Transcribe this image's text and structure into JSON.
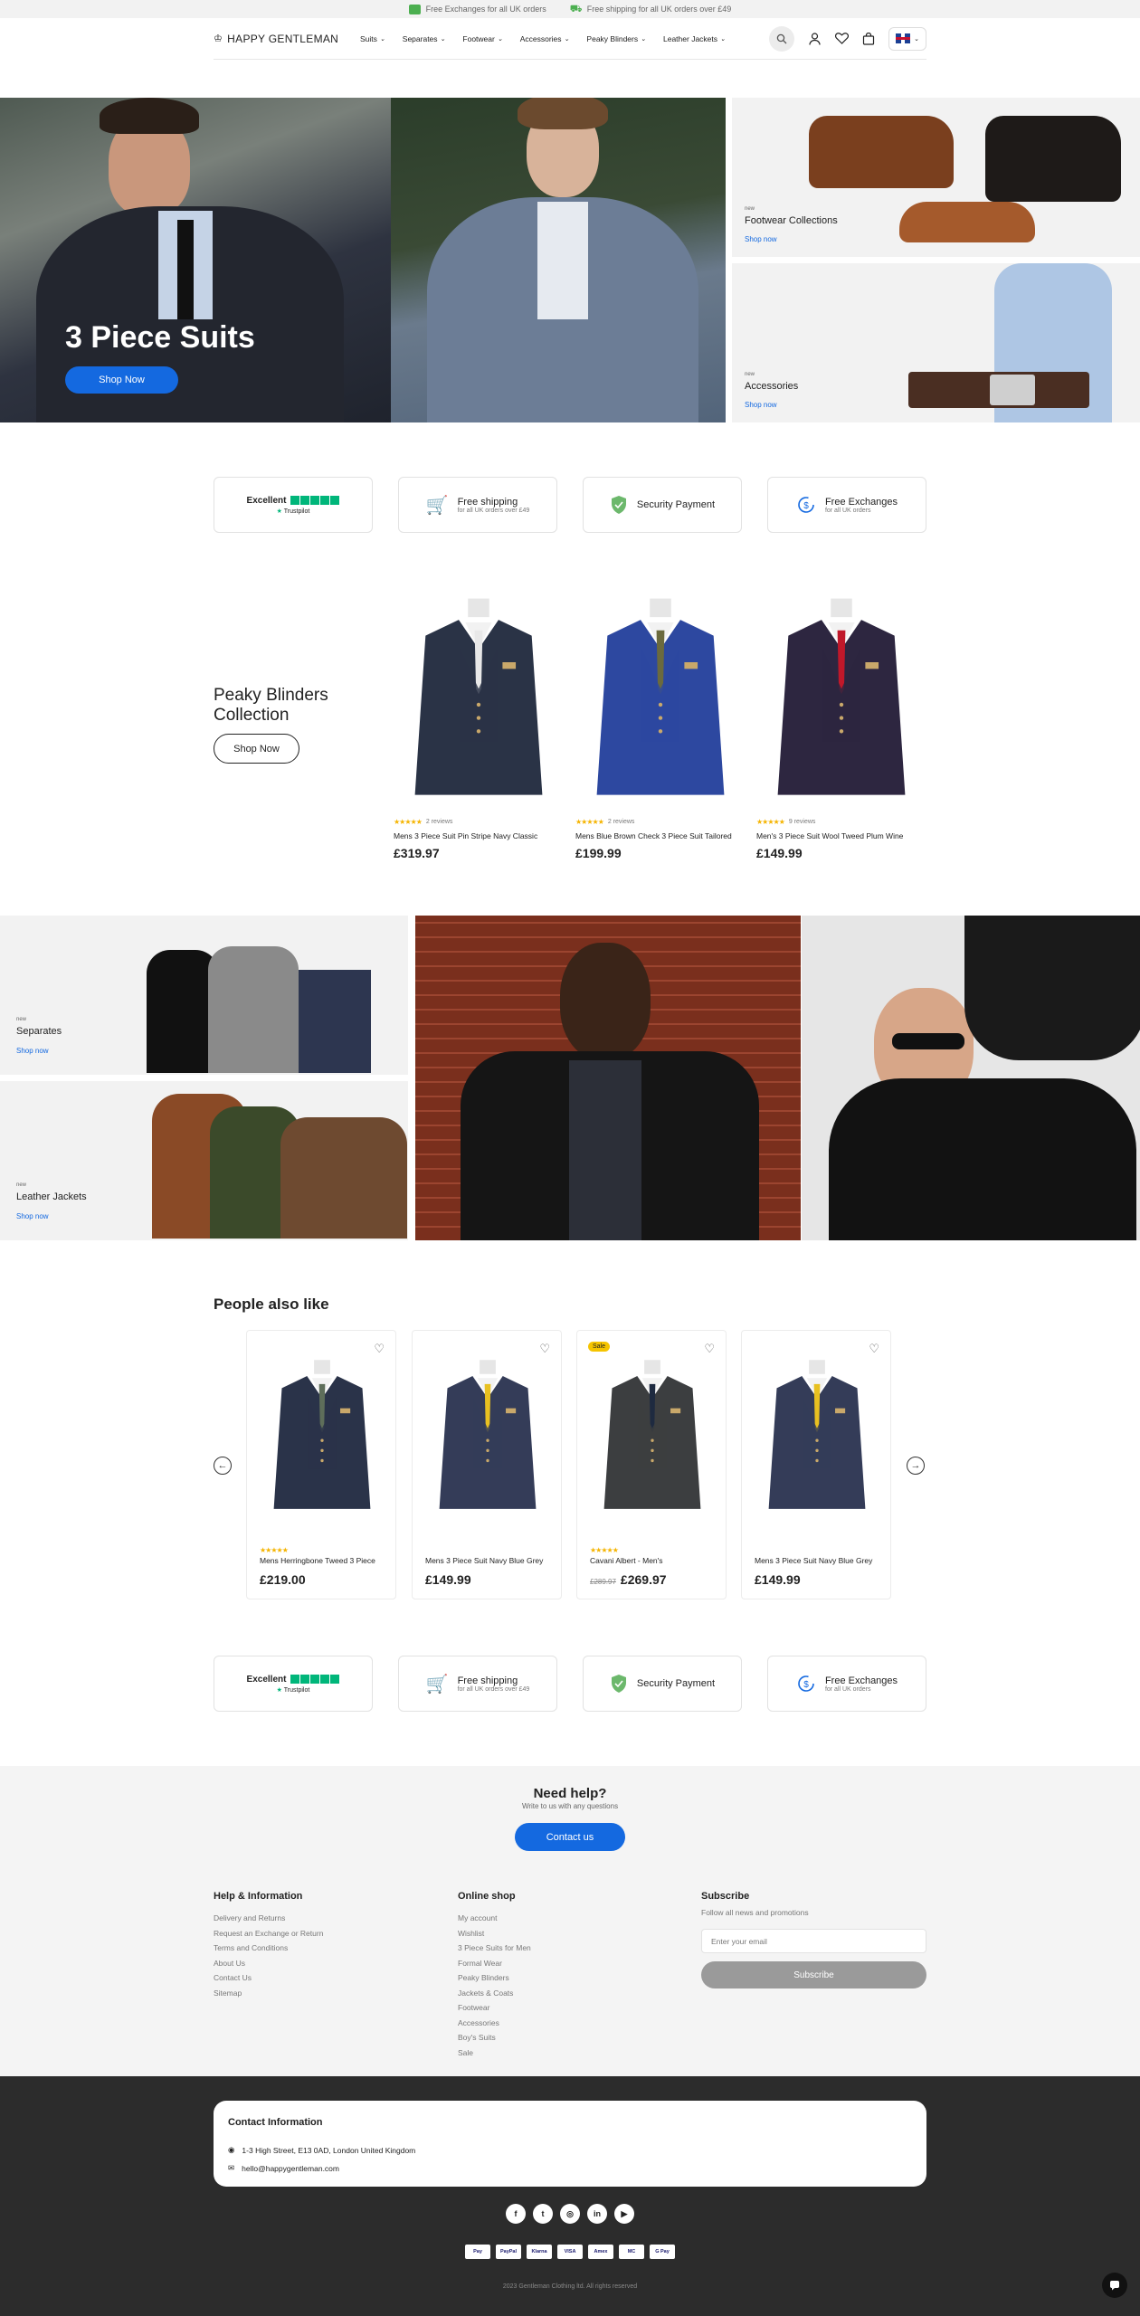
{
  "announcement": [
    {
      "icon": "exchange-icon",
      "text": "Free Exchanges for all UK orders"
    },
    {
      "icon": "truck-icon",
      "text": "Free shipping for all UK orders over £49"
    }
  ],
  "header": {
    "logo": "HAPPY GENTLEMAN",
    "nav": [
      "Suits",
      "Separates",
      "Footwear",
      "Accessories",
      "Peaky Blinders",
      "Leather Jackets"
    ]
  },
  "hero": {
    "title": "3 Piece Suits",
    "button": "Shop Now",
    "tiles": [
      {
        "new": "new",
        "title": "Footwear Collections",
        "link": "Shop now"
      },
      {
        "new": "new",
        "title": "Accessories",
        "link": "Shop now"
      }
    ]
  },
  "trust": {
    "excellent": "Excellent",
    "trustpilot": "Trustpilot",
    "shipping_title": "Free shipping",
    "shipping_sub": "for all UK orders over £49",
    "security_title": "Security Payment",
    "exchange_title": "Free Exchanges",
    "exchange_sub": "for all UK orders"
  },
  "peaky": {
    "title": "Peaky Blinders Collection",
    "button": "Shop Now",
    "products": [
      {
        "reviews": "2 reviews",
        "name": "Mens 3 Piece Suit Pin Stripe Navy Classic",
        "price": "£319.97",
        "suit": "#2a3346",
        "tie": "#e8e8e8"
      },
      {
        "reviews": "2 reviews",
        "name": "Mens Blue Brown Check 3 Piece Suit Tailored",
        "price": "£199.99",
        "suit": "#2d48a0",
        "tie": "#6b6a3e"
      },
      {
        "reviews": "9 reviews",
        "name": "Men's 3 Piece Suit Wool Tweed Plum Wine",
        "price": "£149.99",
        "suit": "#2d2640",
        "tie": "#c0182a"
      }
    ]
  },
  "categories": [
    {
      "new": "new",
      "title": "Separates",
      "link": "Shop now"
    },
    {
      "new": "new",
      "title": "Leather Jackets",
      "link": "Shop now"
    }
  ],
  "people_also_like": {
    "title": "People also like",
    "products": [
      {
        "name": "Mens Herringbone Tweed 3 Piece",
        "price": "£219.00",
        "old": "",
        "sale": "",
        "suit": "#2a3349",
        "tie": "#5e6e5a"
      },
      {
        "name": "Mens 3 Piece Suit Navy Blue Grey",
        "price": "£149.99",
        "old": "",
        "sale": "",
        "suit": "#343c58",
        "tie": "#e8c020"
      },
      {
        "name": "Cavani Albert - Men's",
        "price": "£269.97",
        "old": "£289.97",
        "sale": "Sale",
        "suit": "#3c3e40",
        "tie": "#1e2a40"
      },
      {
        "name": "Mens 3 Piece Suit Navy Blue Grey",
        "price": "£149.99",
        "old": "",
        "sale": "",
        "suit": "#343c58",
        "tie": "#e8c020"
      }
    ]
  },
  "help": {
    "title": "Need help?",
    "subtitle": "Write to us with any questions",
    "button": "Contact us",
    "col1": {
      "title": "Help & Information",
      "links": [
        "Delivery and Returns",
        "Request an Exchange or Return",
        "Terms and Conditions",
        "About Us",
        "Contact Us",
        "Sitemap"
      ]
    },
    "col2": {
      "title": "Online shop",
      "links": [
        "My account",
        "Wishlist",
        "3 Piece Suits for Men",
        "Formal Wear",
        "Peaky Blinders",
        "Jackets & Coats",
        "Footwear",
        "Accessories",
        "Boy's Suits",
        "Sale"
      ]
    },
    "subscribe": {
      "title": "Subscribe",
      "subtitle": "Follow all news and promotions",
      "placeholder": "Enter your email",
      "button": "Subscribe"
    }
  },
  "footer": {
    "contact_title": "Contact Information",
    "address": "1-3 High Street, E13 0AD, London United Kingdom",
    "email": "hello@happygentleman.com",
    "socials": [
      "f",
      "t",
      "◎",
      "in",
      "▶"
    ],
    "payments": [
      "Pay",
      "PayPal",
      "Klarna",
      "VISA",
      "Amex",
      "MC",
      "G Pay"
    ],
    "copyright": "2023 Gentleman Clothing ltd. All rights reserved"
  }
}
